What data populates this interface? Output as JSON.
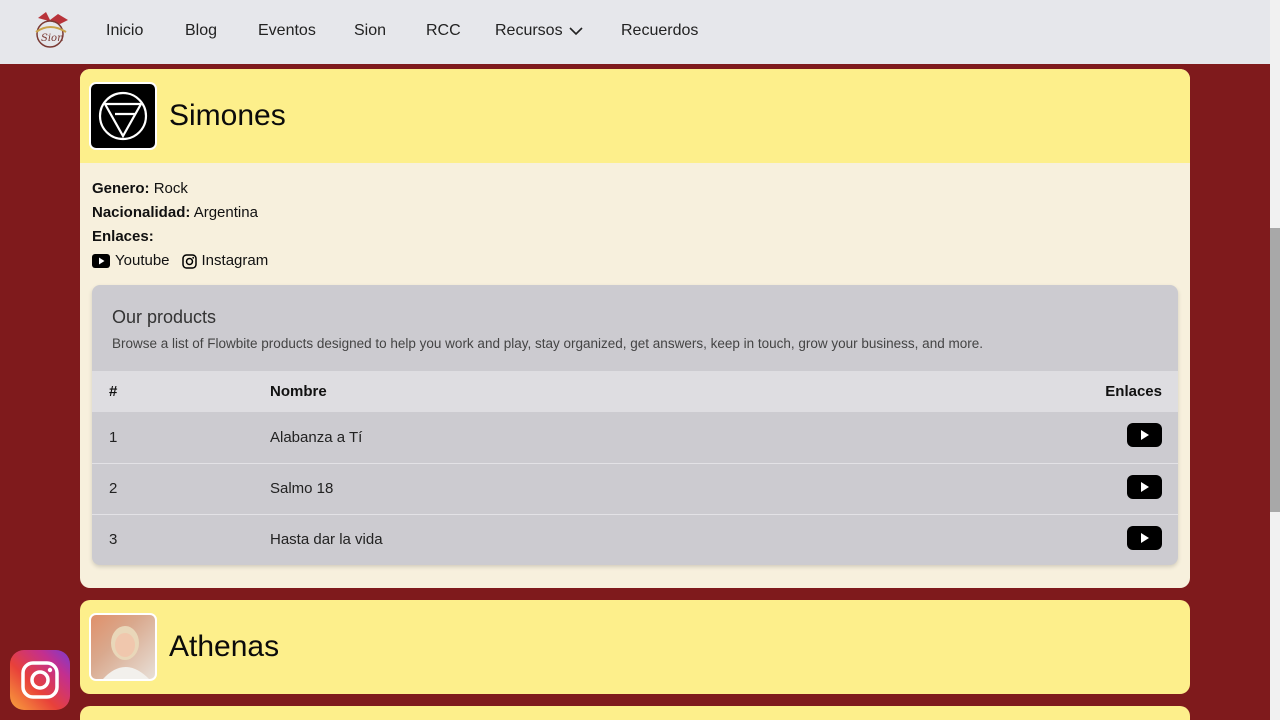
{
  "nav": {
    "items": [
      {
        "label": "Inicio"
      },
      {
        "label": "Blog"
      },
      {
        "label": "Eventos"
      },
      {
        "label": "Sion"
      },
      {
        "label": "RCC"
      },
      {
        "label": "Recursos"
      },
      {
        "label": "Recuerdos"
      }
    ]
  },
  "bands": [
    {
      "name": "Simones",
      "genre_label": "Genero:",
      "genre": "Rock",
      "nationality_label": "Nacionalidad:",
      "nationality": "Argentina",
      "links_label": "Enlaces:",
      "links": [
        {
          "label": "Youtube",
          "icon": "youtube-icon"
        },
        {
          "label": "Instagram",
          "icon": "instagram-icon"
        }
      ],
      "products": {
        "title": "Our products",
        "description": "Browse a list of Flowbite products designed to help you work and play, stay organized, get answers, keep in touch, grow your business, and more.",
        "columns": [
          "#",
          "Nombre",
          "Enlaces"
        ],
        "rows": [
          {
            "num": "1",
            "name": "Alabanza a Tí"
          },
          {
            "num": "2",
            "name": "Salmo 18"
          },
          {
            "num": "3",
            "name": "Hasta dar la vida"
          }
        ]
      }
    },
    {
      "name": "Athenas"
    }
  ],
  "colors": {
    "page_bg": "#7f1a1c",
    "card_header": "#fdef8b",
    "card_body": "#f7f0dd",
    "navbar": "#e6e7eb"
  }
}
